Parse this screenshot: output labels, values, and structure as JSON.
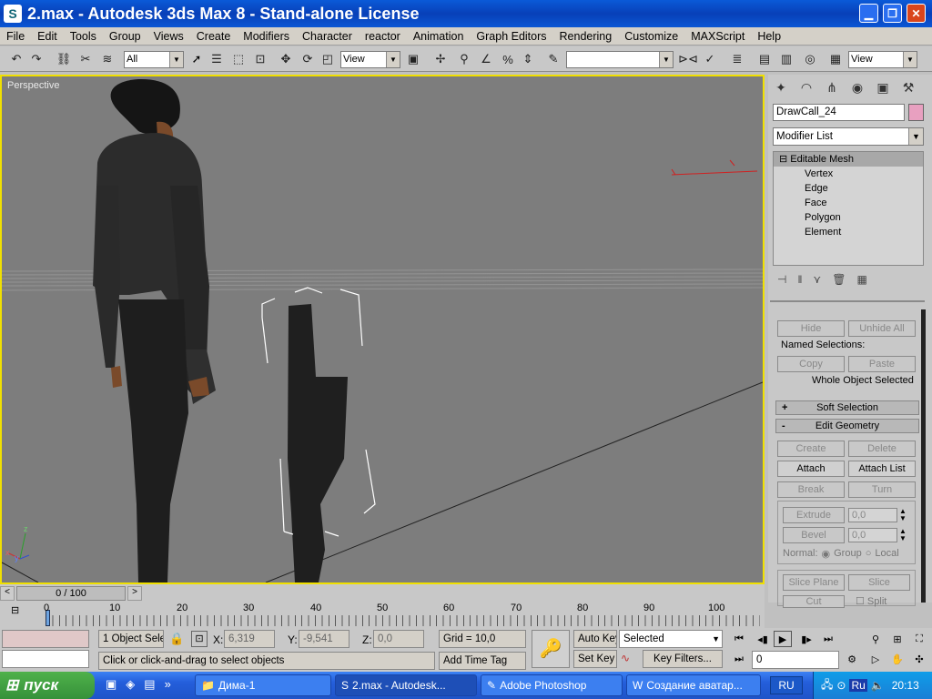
{
  "window": {
    "title": "2.max - Autodesk 3ds Max 8  - Stand-alone License",
    "app_icon": "3dsmax-icon"
  },
  "menu": [
    "File",
    "Edit",
    "Tools",
    "Group",
    "Views",
    "Create",
    "Modifiers",
    "Character",
    "reactor",
    "Animation",
    "Graph Editors",
    "Rendering",
    "Customize",
    "MAXScript",
    "Help"
  ],
  "toolbar": {
    "selection_filter": "All",
    "ref_coord": "View",
    "named_sel": "",
    "render_view": "View"
  },
  "viewport": {
    "label": "Perspective",
    "axis_x": "x",
    "axis_y": "y",
    "axis_z": "z"
  },
  "command_panel": {
    "object_name": "DrawCall_24",
    "object_color": "#e8a0c0",
    "modifier_list": "Modifier List",
    "stack": {
      "root": "Editable Mesh",
      "items": [
        "Vertex",
        "Edge",
        "Face",
        "Polygon",
        "Element"
      ]
    },
    "selection": {
      "hide": "Hide",
      "unhide_all": "Unhide All",
      "named_selections": "Named Selections:",
      "copy": "Copy",
      "paste": "Paste",
      "status": "Whole Object Selected"
    },
    "soft_selection": {
      "sign": "+",
      "label": "Soft Selection"
    },
    "edit_geometry": {
      "sign": "-",
      "label": "Edit Geometry",
      "create": "Create",
      "delete": "Delete",
      "attach": "Attach",
      "attach_list": "Attach List",
      "break": "Break",
      "turn": "Turn",
      "extrude": "Extrude",
      "extrude_val": "0,0",
      "bevel": "Bevel",
      "bevel_val": "0,0",
      "normal": "Normal:",
      "group": "Group",
      "local": "Local",
      "slice_plane": "Slice Plane",
      "slice": "Slice",
      "cut": "Cut",
      "split": "Split"
    }
  },
  "timeline": {
    "slider": "0 / 100",
    "ticks": [
      "0",
      "10",
      "20",
      "30",
      "40",
      "50",
      "60",
      "70",
      "80",
      "90",
      "100"
    ]
  },
  "status": {
    "selection_count": "1 Object Sele",
    "x_label": "X:",
    "x": "6,319",
    "y_label": "Y:",
    "y": "-9,541",
    "z_label": "Z:",
    "z": "0,0",
    "grid": "Grid = 10,0",
    "prompt": "Click or click-and-drag to select objects",
    "add_time_tag": "Add Time Tag",
    "auto_key": "Auto Key",
    "set_key": "Set Key",
    "key_mode": "Selected",
    "key_filters": "Key Filters...",
    "frame": "0"
  },
  "taskbar": {
    "start": "пуск",
    "tasks": [
      "Дима-1",
      "2.max - Autodesk...",
      "Adobe Photoshop",
      "Создание аватар..."
    ],
    "lang": "RU",
    "tray_lang": "Ru",
    "clock": "20:13"
  }
}
